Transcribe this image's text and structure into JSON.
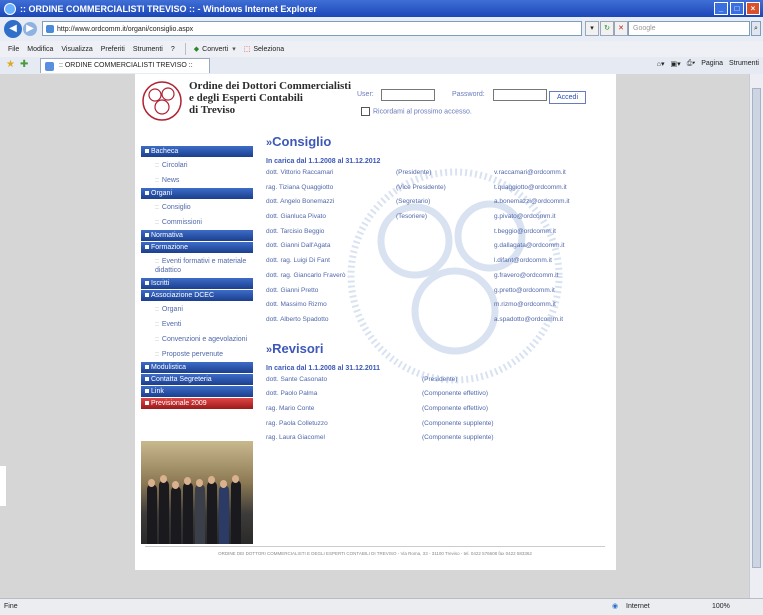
{
  "browser": {
    "title": ":: ORDINE COMMERCIALISTI TREVISO :: - Windows Internet Explorer",
    "url": "http://www.ordcomm.it/organi/consiglio.aspx",
    "search_placeholder": "Google",
    "menu": [
      "File",
      "Modifica",
      "Visualizza",
      "Preferiti",
      "Strumenti",
      "?"
    ],
    "convert_label": "Converti",
    "select_label": "Seleziona",
    "tab_title": ":: ORDINE COMMERCIALISTI TREVISO ::",
    "cmd_page": "Pagina",
    "cmd_tools": "Strumenti",
    "status_left": "Fine",
    "status_zone": "Internet",
    "status_zoom": "100%"
  },
  "header": {
    "org_line1": "Ordine dei Dottori Commercialisti",
    "org_line2": "e degli Esperti Contabili",
    "org_line3": "di Treviso",
    "user_label": "User:",
    "password_label": "Password:",
    "login_button": "Accedi",
    "remember_label": "Ricordami al prossimo accesso."
  },
  "sidebar": {
    "bacheca": "Bacheca",
    "circolari": "Circolari",
    "news": "News",
    "organi": "Organi",
    "consiglio": "Consiglio",
    "commissioni": "Commissioni",
    "normativa": "Normativa",
    "formazione": "Formazione",
    "eventi_formativi": "Eventi formativi e materiale didattico",
    "iscritti": "Iscritti",
    "associazione": "Associazione DCEC",
    "assoc_organi": "Organi",
    "assoc_eventi": "Eventi",
    "convenzioni": "Convenzioni e agevolazioni",
    "proposte": "Proposte pervenute",
    "modulistica": "Modulistica",
    "contatta": "Contatta Segreteria",
    "link": "Link",
    "previsionale": "Previsionale 2009"
  },
  "consiglio": {
    "title": "Consiglio",
    "period": "In carica dal 1.1.2008 al 31.12.2012",
    "members": [
      {
        "name": "dott. Vittorio Raccamari",
        "role": "(Presidente)",
        "email": "v.raccamari@ordcomm.it"
      },
      {
        "name": "rag. Tiziana Quaggiotto",
        "role": "(Vice Presidente)",
        "email": "t.quaggiotto@ordcomm.it"
      },
      {
        "name": "dott. Angelo Bonemazzi",
        "role": "(Segretario)",
        "email": "a.bonemazzi@ordcomm.it"
      },
      {
        "name": "dott. Gianluca Pivato",
        "role": "(Tesoriere)",
        "email": "g.pivato@ordcomm.it"
      },
      {
        "name": "dott. Tarcisio Beggio",
        "role": "",
        "email": "t.beggio@ordcomm.it"
      },
      {
        "name": "dott. Gianni Dall'Agata",
        "role": "",
        "email": "g.dallagata@ordcomm.it"
      },
      {
        "name": "dott. rag. Luigi Di Fant",
        "role": "",
        "email": "l.difant@ordcomm.it"
      },
      {
        "name": "dott. rag. Giancarlo Fraverò",
        "role": "",
        "email": "g.fravero@ordcomm.it"
      },
      {
        "name": "dott. Gianni Pretto",
        "role": "",
        "email": "g.pretto@ordcomm.it"
      },
      {
        "name": "dott. Massimo Rizmo",
        "role": "",
        "email": "m.rizmo@ordcomm.it"
      },
      {
        "name": "dott. Alberto Spadotto",
        "role": "",
        "email": "a.spadotto@ordcomm.it"
      }
    ]
  },
  "revisori": {
    "title": "Revisori",
    "period": "In carica dal 1.1.2008 al 31.12.2011",
    "members": [
      {
        "name": "dott. Sante Casonato",
        "role": "(Presidente)"
      },
      {
        "name": "dott. Paolo Palma",
        "role": "(Componente effettivo)"
      },
      {
        "name": "rag. Mario Conte",
        "role": "(Componente effettivo)"
      },
      {
        "name": "rag. Paola Colletuzzo",
        "role": "(Componente supplente)"
      },
      {
        "name": "rag. Laura Giacomel",
        "role": "(Componente supplente)"
      }
    ]
  },
  "footer": "ORDINE DEI DOTTORI COMMERCIALISTI E DEGLI ESPERTI CONTABILI DI TREVISO - Via Roma, 33 - 31100 Treviso - tel. 0422 576608 fax 0422 583362",
  "colors": {
    "accent": "#3d58b8",
    "menu": "#1c3f8e",
    "highlight": "#c02020"
  }
}
